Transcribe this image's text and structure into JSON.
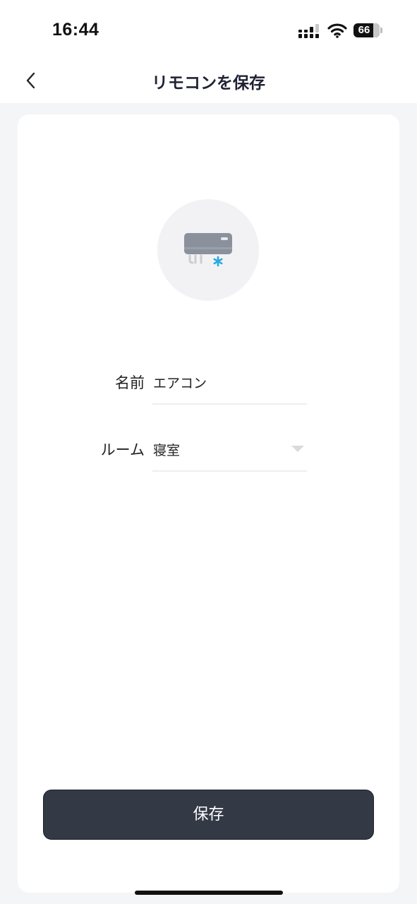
{
  "status": {
    "time": "16:44",
    "battery_level": "66"
  },
  "nav": {
    "title": "リモコンを保存"
  },
  "form": {
    "name_label": "名前",
    "name_value": "エアコン",
    "room_label": "ルーム",
    "room_value": "寝室"
  },
  "actions": {
    "save_label": "保存"
  },
  "icons": {
    "back": "chevron-left-icon",
    "device": "air-conditioner-icon",
    "dropdown": "caret-down-icon"
  },
  "colors": {
    "accent_snowflake": "#2aa8e0",
    "button_bg": "#343946",
    "page_bg": "#f4f5f7"
  }
}
